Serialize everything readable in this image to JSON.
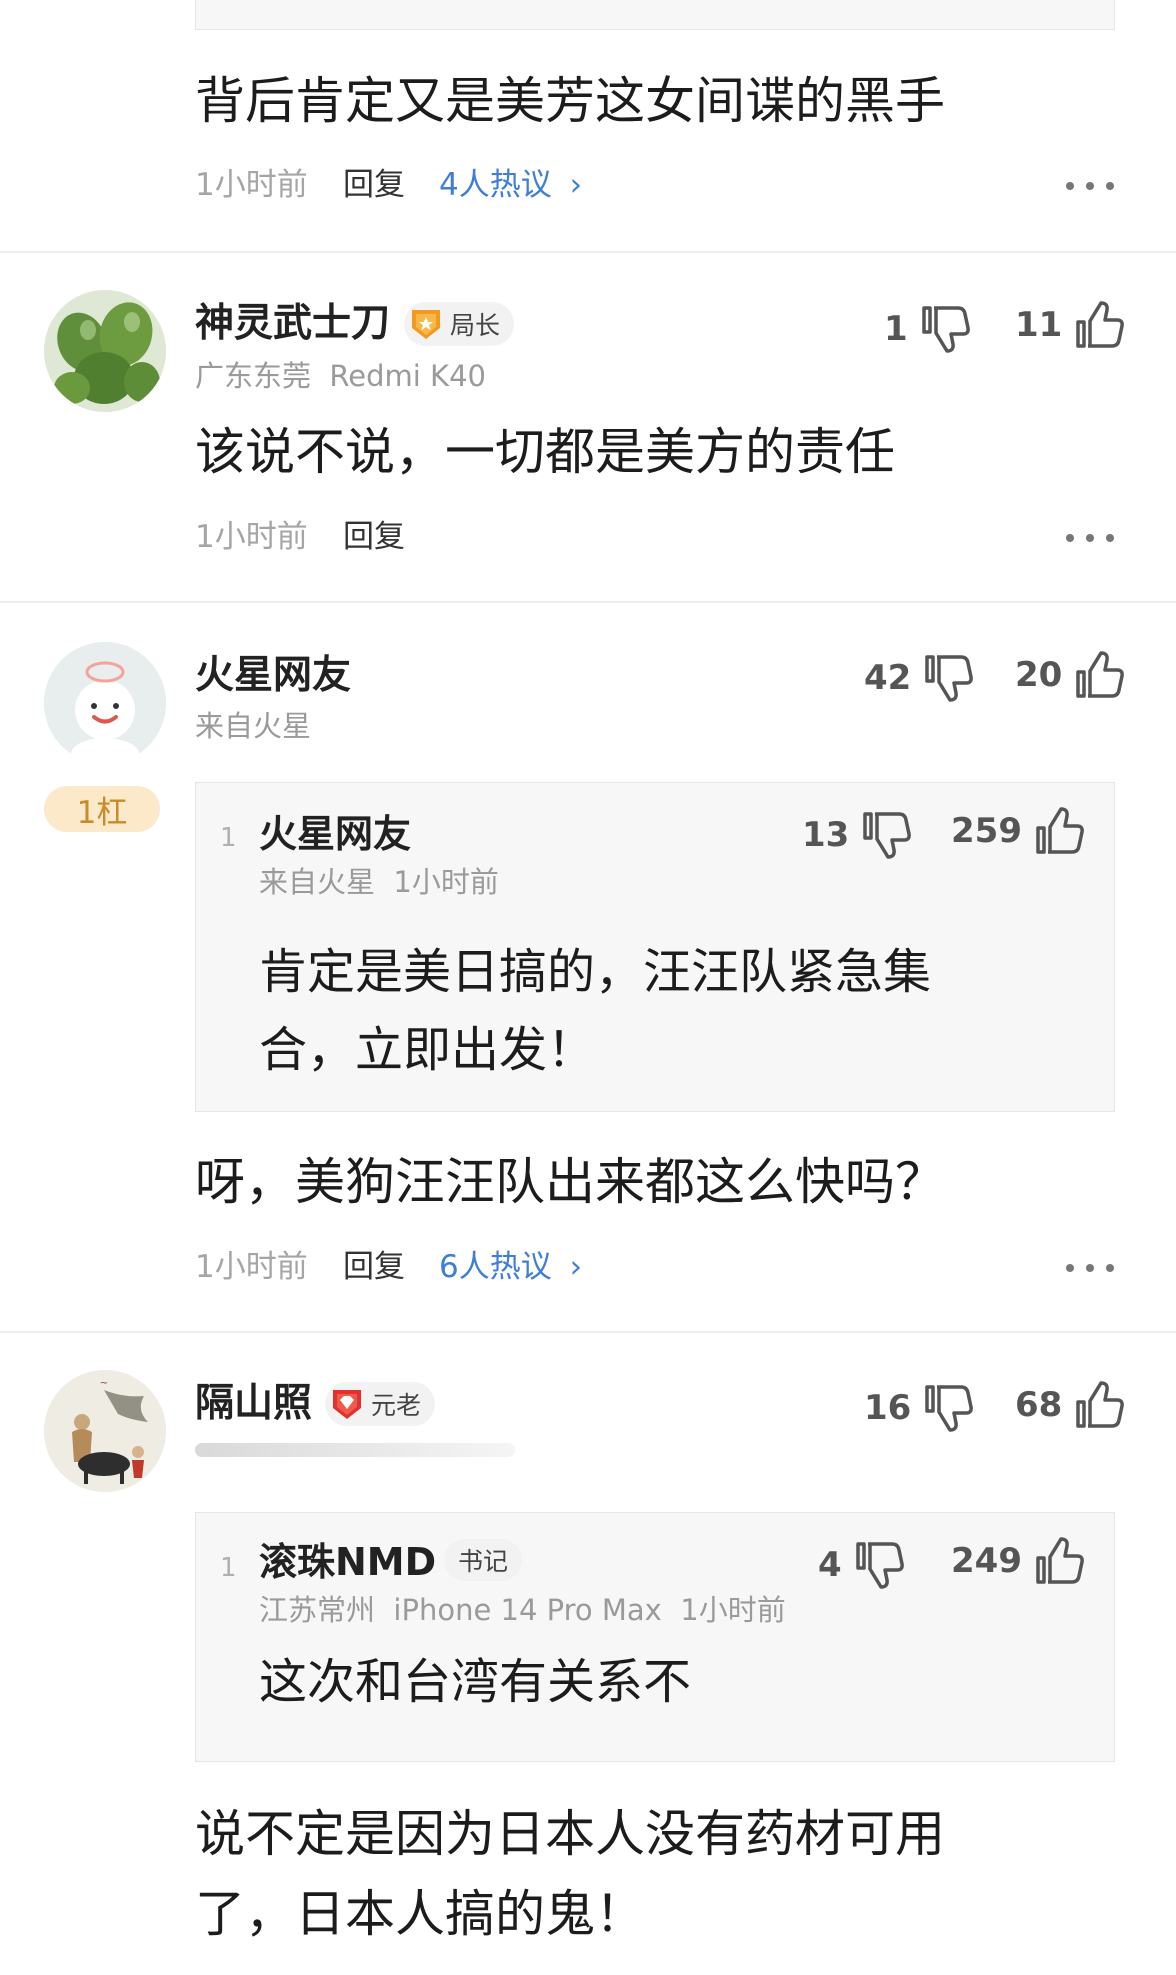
{
  "comment0": {
    "text": "背后肯定又是美芳这女间谍的黑手",
    "time": "1小时前",
    "reply": "回复",
    "hot": "4人热议",
    "hot_arrow": "›"
  },
  "comment1": {
    "name": "神灵武士刀",
    "badge": "局长",
    "meta": "广东东莞  Redmi K40",
    "dislikes": "1",
    "likes": "11",
    "text": "该说不说，一切都是美方的责任",
    "time": "1小时前",
    "reply": "回复"
  },
  "comment2": {
    "name": "火星网友",
    "meta": "来自火星",
    "rank": "1杠",
    "dislikes": "42",
    "likes": "20",
    "quote": {
      "index": "1",
      "name": "火星网友",
      "meta": "来自火星  1小时前",
      "dislikes": "13",
      "likes": "259",
      "line1": "肯定是美日搞的，汪汪队紧急集",
      "line2": "合，立即出发！"
    },
    "text": "呀，美狗汪汪队出来都这么快吗？",
    "time": "1小时前",
    "reply": "回复",
    "hot": "6人热议",
    "hot_arrow": "›"
  },
  "comment3": {
    "name": "隔山照",
    "badge": "元老",
    "dislikes": "16",
    "likes": "68",
    "quote": {
      "index": "1",
      "name": "滚珠NMD",
      "badge": "书记",
      "meta": "江苏常州  iPhone 14 Pro Max  1小时前",
      "dislikes": "4",
      "likes": "249",
      "line1": "这次和台湾有关系不"
    },
    "line1": "说不定是因为日本人没有药材可用",
    "line2": "了，日本人搞的鬼！"
  },
  "icons": {
    "dislike": "thumb-down-icon",
    "like": "thumb-up-icon",
    "more": "more-dots-icon",
    "badge_bureau": "orange-medal-icon",
    "badge_elder": "red-diamond-shield-icon"
  },
  "colors": {
    "link": "#3f7ed6",
    "rank_bg": "#fbe9c9",
    "rank_text": "#c98a2a"
  }
}
